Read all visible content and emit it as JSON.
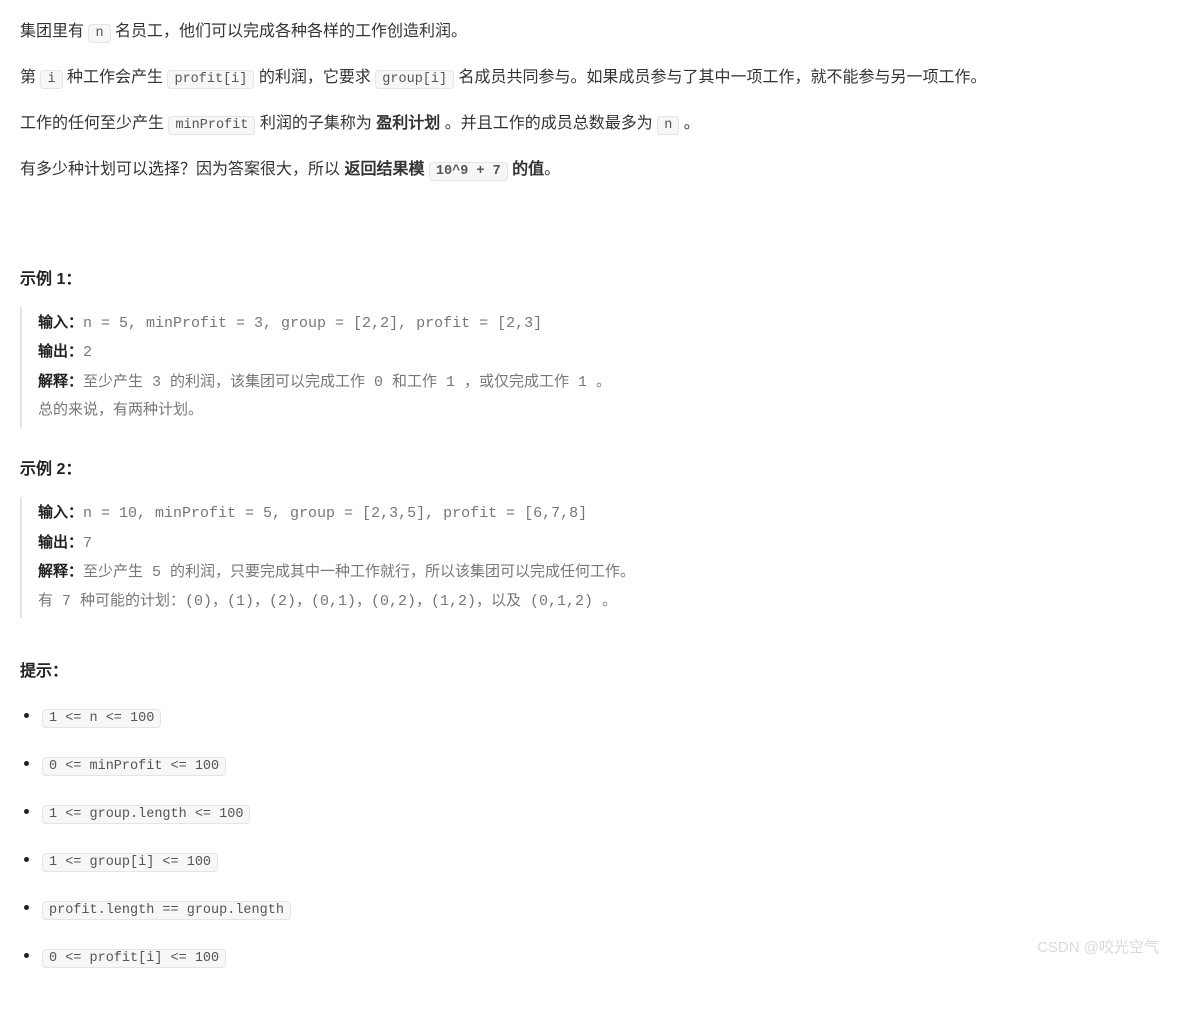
{
  "p1": {
    "a": "集团里有 ",
    "c1": "n",
    "b": " 名员工，他们可以完成各种各样的工作创造利润。"
  },
  "p2": {
    "a": "第 ",
    "c1": "i",
    "b": " 种工作会产生 ",
    "c2": "profit[i]",
    "c": " 的利润，它要求 ",
    "c3": "group[i]",
    "d": " 名成员共同参与。如果成员参与了其中一项工作，就不能参与另一项工作。"
  },
  "p3": {
    "a": "工作的任何至少产生 ",
    "c1": "minProfit",
    "b": " 利润的子集称为 ",
    "s": "盈利计划",
    "c": " 。并且工作的成员总数最多为 ",
    "c2": "n",
    "d": " 。"
  },
  "p4": {
    "a": "有多少种计划可以选择？因为答案很大，所以 ",
    "s": "返回结果模 ",
    "c1": "10^9 + 7",
    "s2": " 的值",
    "b": "。"
  },
  "ex1": {
    "title": "示例 1：",
    "in_lbl": "输入：",
    "in_val": "n = 5, minProfit = 3, group = [2,2], profit = [2,3]",
    "out_lbl": "输出：",
    "out_val": "2",
    "exp_lbl": "解释：",
    "exp_val": "至少产生 3 的利润，该集团可以完成工作 0 和工作 1 ，或仅完成工作 1 。",
    "extra": "总的来说，有两种计划。"
  },
  "ex2": {
    "title": "示例 2：",
    "in_lbl": "输入：",
    "in_val": "n = 10, minProfit = 5, group = [2,3,5], profit = [6,7,8]",
    "out_lbl": "输出：",
    "out_val": "7",
    "exp_lbl": "解释：",
    "exp_val": "至少产生 5 的利润，只要完成其中一种工作就行，所以该集团可以完成任何工作。",
    "extra": "有 7 种可能的计划：(0)，(1)，(2)，(0,1)，(0,2)，(1,2)，以及 (0,1,2) 。"
  },
  "hints": {
    "title": "提示：",
    "items": [
      "1 <= n <= 100",
      "0 <= minProfit <= 100",
      "1 <= group.length <= 100",
      "1 <= group[i] <= 100",
      "profit.length == group.length",
      "0 <= profit[i] <= 100"
    ]
  },
  "watermark": "CSDN @咬光空气"
}
